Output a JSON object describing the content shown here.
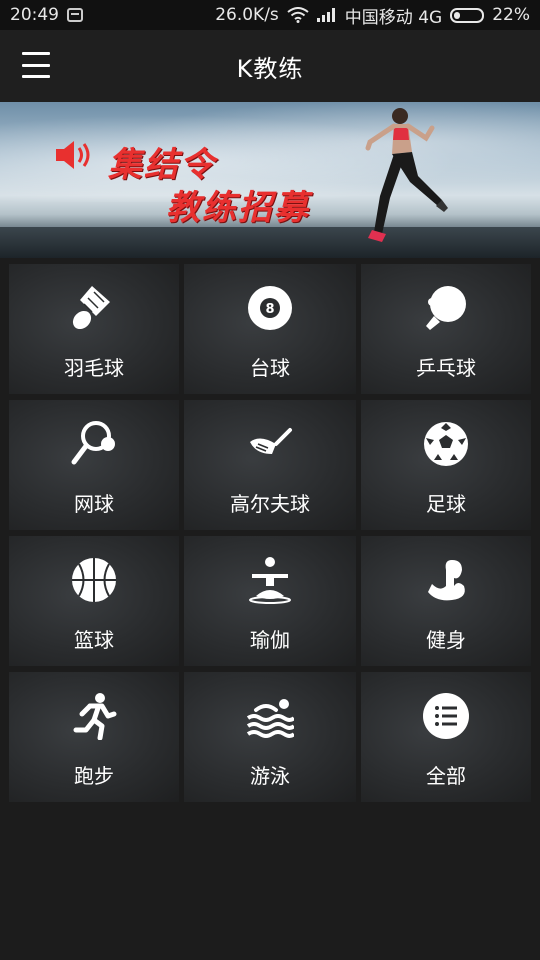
{
  "status_bar": {
    "time": "20:49",
    "net_speed": "26.0K/s",
    "carrier": "中国移动 4G",
    "battery": "22%"
  },
  "header": {
    "title": "K教练",
    "menu_icon": "menu-icon"
  },
  "banner": {
    "line1": "集结令",
    "line2": "教练招募",
    "icon": "speaker-icon",
    "accent": "#e8302f"
  },
  "categories": [
    {
      "label": "羽毛球",
      "icon": "shuttlecock-icon"
    },
    {
      "label": "台球",
      "icon": "billiard-ball-icon"
    },
    {
      "label": "乒乓球",
      "icon": "ping-pong-icon"
    },
    {
      "label": "网球",
      "icon": "tennis-icon"
    },
    {
      "label": "高尔夫球",
      "icon": "golf-club-icon"
    },
    {
      "label": "足球",
      "icon": "soccer-ball-icon"
    },
    {
      "label": "篮球",
      "icon": "basketball-icon"
    },
    {
      "label": "瑜伽",
      "icon": "yoga-icon"
    },
    {
      "label": "健身",
      "icon": "muscle-arm-icon"
    },
    {
      "label": "跑步",
      "icon": "runner-icon"
    },
    {
      "label": "游泳",
      "icon": "swimming-icon"
    },
    {
      "label": "全部",
      "icon": "list-icon"
    }
  ]
}
